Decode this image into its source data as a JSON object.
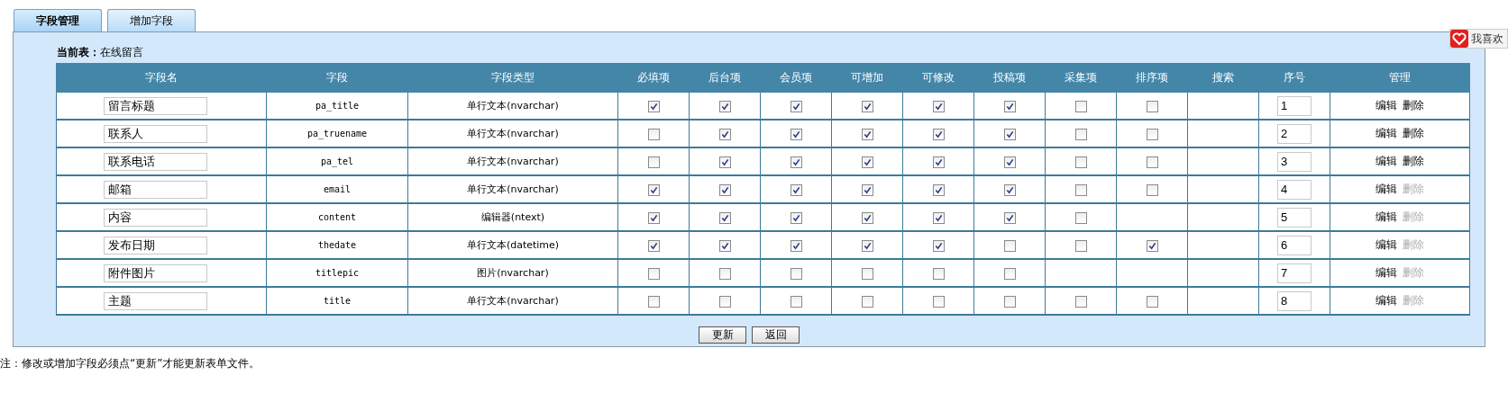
{
  "tabs": [
    {
      "label": "字段管理",
      "selected": true
    },
    {
      "label": "增加字段",
      "selected": false
    }
  ],
  "current_table": {
    "label": "当前表：",
    "value": "在线留言"
  },
  "table": {
    "columns": [
      "字段名",
      "字段",
      "字段类型",
      "必填项",
      "后台项",
      "会员项",
      "可增加",
      "可修改",
      "投稿项",
      "采集项",
      "排序项",
      "搜索",
      "序号",
      "管理"
    ],
    "rows": [
      {
        "name": "留言标题",
        "field": "pa_title",
        "type": "单行文本(nvarchar)",
        "flags": [
          {
            "kind": "checkbox",
            "checked": true
          },
          {
            "kind": "checkbox",
            "checked": true
          },
          {
            "kind": "checkbox",
            "checked": true
          },
          {
            "kind": "checkbox",
            "checked": true
          },
          {
            "kind": "checkbox",
            "checked": true
          },
          {
            "kind": "checkbox",
            "checked": true
          },
          {
            "kind": "checkbox",
            "checked": false
          },
          {
            "kind": "checkbox",
            "checked": false
          },
          {
            "kind": "empty"
          }
        ],
        "order": "1",
        "edit": "编辑",
        "delete": {
          "label": "删除",
          "disabled": false
        }
      },
      {
        "name": "联系人",
        "field": "pa_truename",
        "type": "单行文本(nvarchar)",
        "flags": [
          {
            "kind": "checkbox",
            "checked": false
          },
          {
            "kind": "checkbox",
            "checked": true
          },
          {
            "kind": "checkbox",
            "checked": true
          },
          {
            "kind": "checkbox",
            "checked": true
          },
          {
            "kind": "checkbox",
            "checked": true
          },
          {
            "kind": "checkbox",
            "checked": true
          },
          {
            "kind": "checkbox",
            "checked": false
          },
          {
            "kind": "checkbox",
            "checked": false
          },
          {
            "kind": "empty"
          }
        ],
        "order": "2",
        "edit": "编辑",
        "delete": {
          "label": "删除",
          "disabled": false
        }
      },
      {
        "name": "联系电话",
        "field": "pa_tel",
        "type": "单行文本(nvarchar)",
        "flags": [
          {
            "kind": "checkbox",
            "checked": false
          },
          {
            "kind": "checkbox",
            "checked": true
          },
          {
            "kind": "checkbox",
            "checked": true
          },
          {
            "kind": "checkbox",
            "checked": true
          },
          {
            "kind": "checkbox",
            "checked": true
          },
          {
            "kind": "checkbox",
            "checked": true
          },
          {
            "kind": "checkbox",
            "checked": false
          },
          {
            "kind": "checkbox",
            "checked": false
          },
          {
            "kind": "empty"
          }
        ],
        "order": "3",
        "edit": "编辑",
        "delete": {
          "label": "删除",
          "disabled": false
        }
      },
      {
        "name": "邮箱",
        "field": "email",
        "type": "单行文本(nvarchar)",
        "flags": [
          {
            "kind": "checkbox",
            "checked": true
          },
          {
            "kind": "checkbox",
            "checked": true
          },
          {
            "kind": "checkbox",
            "checked": true
          },
          {
            "kind": "checkbox",
            "checked": true
          },
          {
            "kind": "checkbox",
            "checked": true
          },
          {
            "kind": "checkbox",
            "checked": true
          },
          {
            "kind": "checkbox",
            "checked": false
          },
          {
            "kind": "checkbox",
            "checked": false
          },
          {
            "kind": "empty"
          }
        ],
        "order": "4",
        "edit": "编辑",
        "delete": {
          "label": "删除",
          "disabled": true
        }
      },
      {
        "name": "内容",
        "field": "content",
        "type": "编辑器(ntext)",
        "flags": [
          {
            "kind": "checkbox",
            "checked": true
          },
          {
            "kind": "checkbox",
            "checked": true
          },
          {
            "kind": "checkbox",
            "checked": true
          },
          {
            "kind": "checkbox",
            "checked": true
          },
          {
            "kind": "checkbox",
            "checked": true
          },
          {
            "kind": "checkbox",
            "checked": true
          },
          {
            "kind": "checkbox",
            "checked": false
          },
          {
            "kind": "empty"
          },
          {
            "kind": "empty"
          }
        ],
        "order": "5",
        "edit": "编辑",
        "delete": {
          "label": "删除",
          "disabled": true
        }
      },
      {
        "name": "发布日期",
        "field": "thedate",
        "type": "单行文本(datetime)",
        "flags": [
          {
            "kind": "checkbox",
            "checked": true
          },
          {
            "kind": "checkbox",
            "checked": true
          },
          {
            "kind": "checkbox",
            "checked": true
          },
          {
            "kind": "checkbox",
            "checked": true
          },
          {
            "kind": "checkbox",
            "checked": true
          },
          {
            "kind": "checkbox",
            "checked": false
          },
          {
            "kind": "checkbox",
            "checked": false
          },
          {
            "kind": "checkbox",
            "checked": true
          },
          {
            "kind": "empty"
          }
        ],
        "order": "6",
        "edit": "编辑",
        "delete": {
          "label": "删除",
          "disabled": true
        }
      },
      {
        "name": "附件图片",
        "field": "titlepic",
        "type": "图片(nvarchar)",
        "flags": [
          {
            "kind": "checkbox",
            "checked": false
          },
          {
            "kind": "checkbox",
            "checked": false
          },
          {
            "kind": "checkbox",
            "checked": false
          },
          {
            "kind": "checkbox",
            "checked": false
          },
          {
            "kind": "checkbox",
            "checked": false
          },
          {
            "kind": "checkbox",
            "checked": false
          },
          {
            "kind": "empty"
          },
          {
            "kind": "empty"
          },
          {
            "kind": "empty"
          }
        ],
        "order": "7",
        "edit": "编辑",
        "delete": {
          "label": "删除",
          "disabled": true
        }
      },
      {
        "name": "主题",
        "field": "title",
        "type": "单行文本(nvarchar)",
        "flags": [
          {
            "kind": "checkbox",
            "checked": false
          },
          {
            "kind": "checkbox",
            "checked": false
          },
          {
            "kind": "checkbox",
            "checked": false
          },
          {
            "kind": "checkbox",
            "checked": false
          },
          {
            "kind": "checkbox",
            "checked": false
          },
          {
            "kind": "checkbox",
            "checked": false
          },
          {
            "kind": "checkbox",
            "checked": false
          },
          {
            "kind": "checkbox",
            "checked": false
          },
          {
            "kind": "empty"
          }
        ],
        "order": "8",
        "edit": "编辑",
        "delete": {
          "label": "删除",
          "disabled": true
        }
      }
    ]
  },
  "buttons": [
    "更新",
    "返回"
  ],
  "note": "注：修改或增加字段必须点“更新”才能更新表单文件。",
  "like_widget": {
    "label": "我喜欢"
  }
}
